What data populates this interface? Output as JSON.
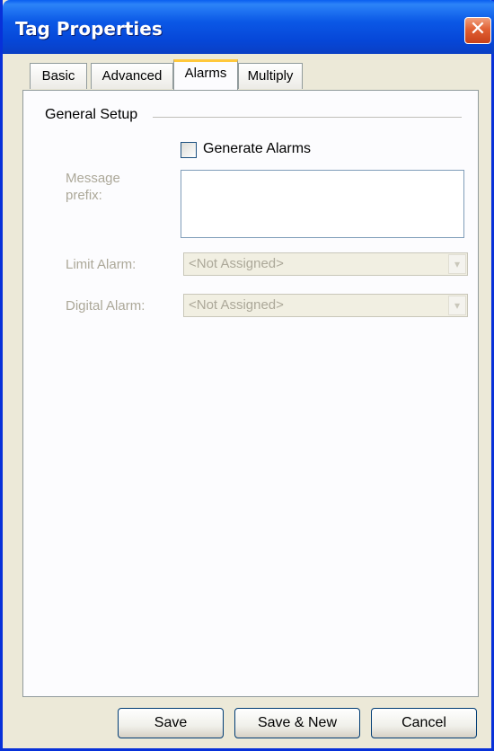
{
  "window": {
    "title": "Tag Properties",
    "close_symbol": "✕"
  },
  "tabs": [
    {
      "label": "Basic"
    },
    {
      "label": "Advanced"
    },
    {
      "label": "Alarms"
    },
    {
      "label": "Multiply"
    }
  ],
  "active_tab": "Alarms",
  "general_setup": {
    "section_label": "General Setup",
    "generate_alarms_label": "Generate Alarms",
    "generate_alarms_checked": false,
    "message_prefix_label_line1": "Message",
    "message_prefix_label_line2": "prefix:",
    "message_prefix_value": "",
    "limit_alarm_label": "Limit Alarm:",
    "limit_alarm_value": "<Not Assigned>",
    "digital_alarm_label": "Digital Alarm:",
    "digital_alarm_value": "<Not Assigned>",
    "dropdown_arrow": "▾"
  },
  "buttons": {
    "save": "Save",
    "save_new": "Save & New",
    "cancel": "Cancel"
  }
}
